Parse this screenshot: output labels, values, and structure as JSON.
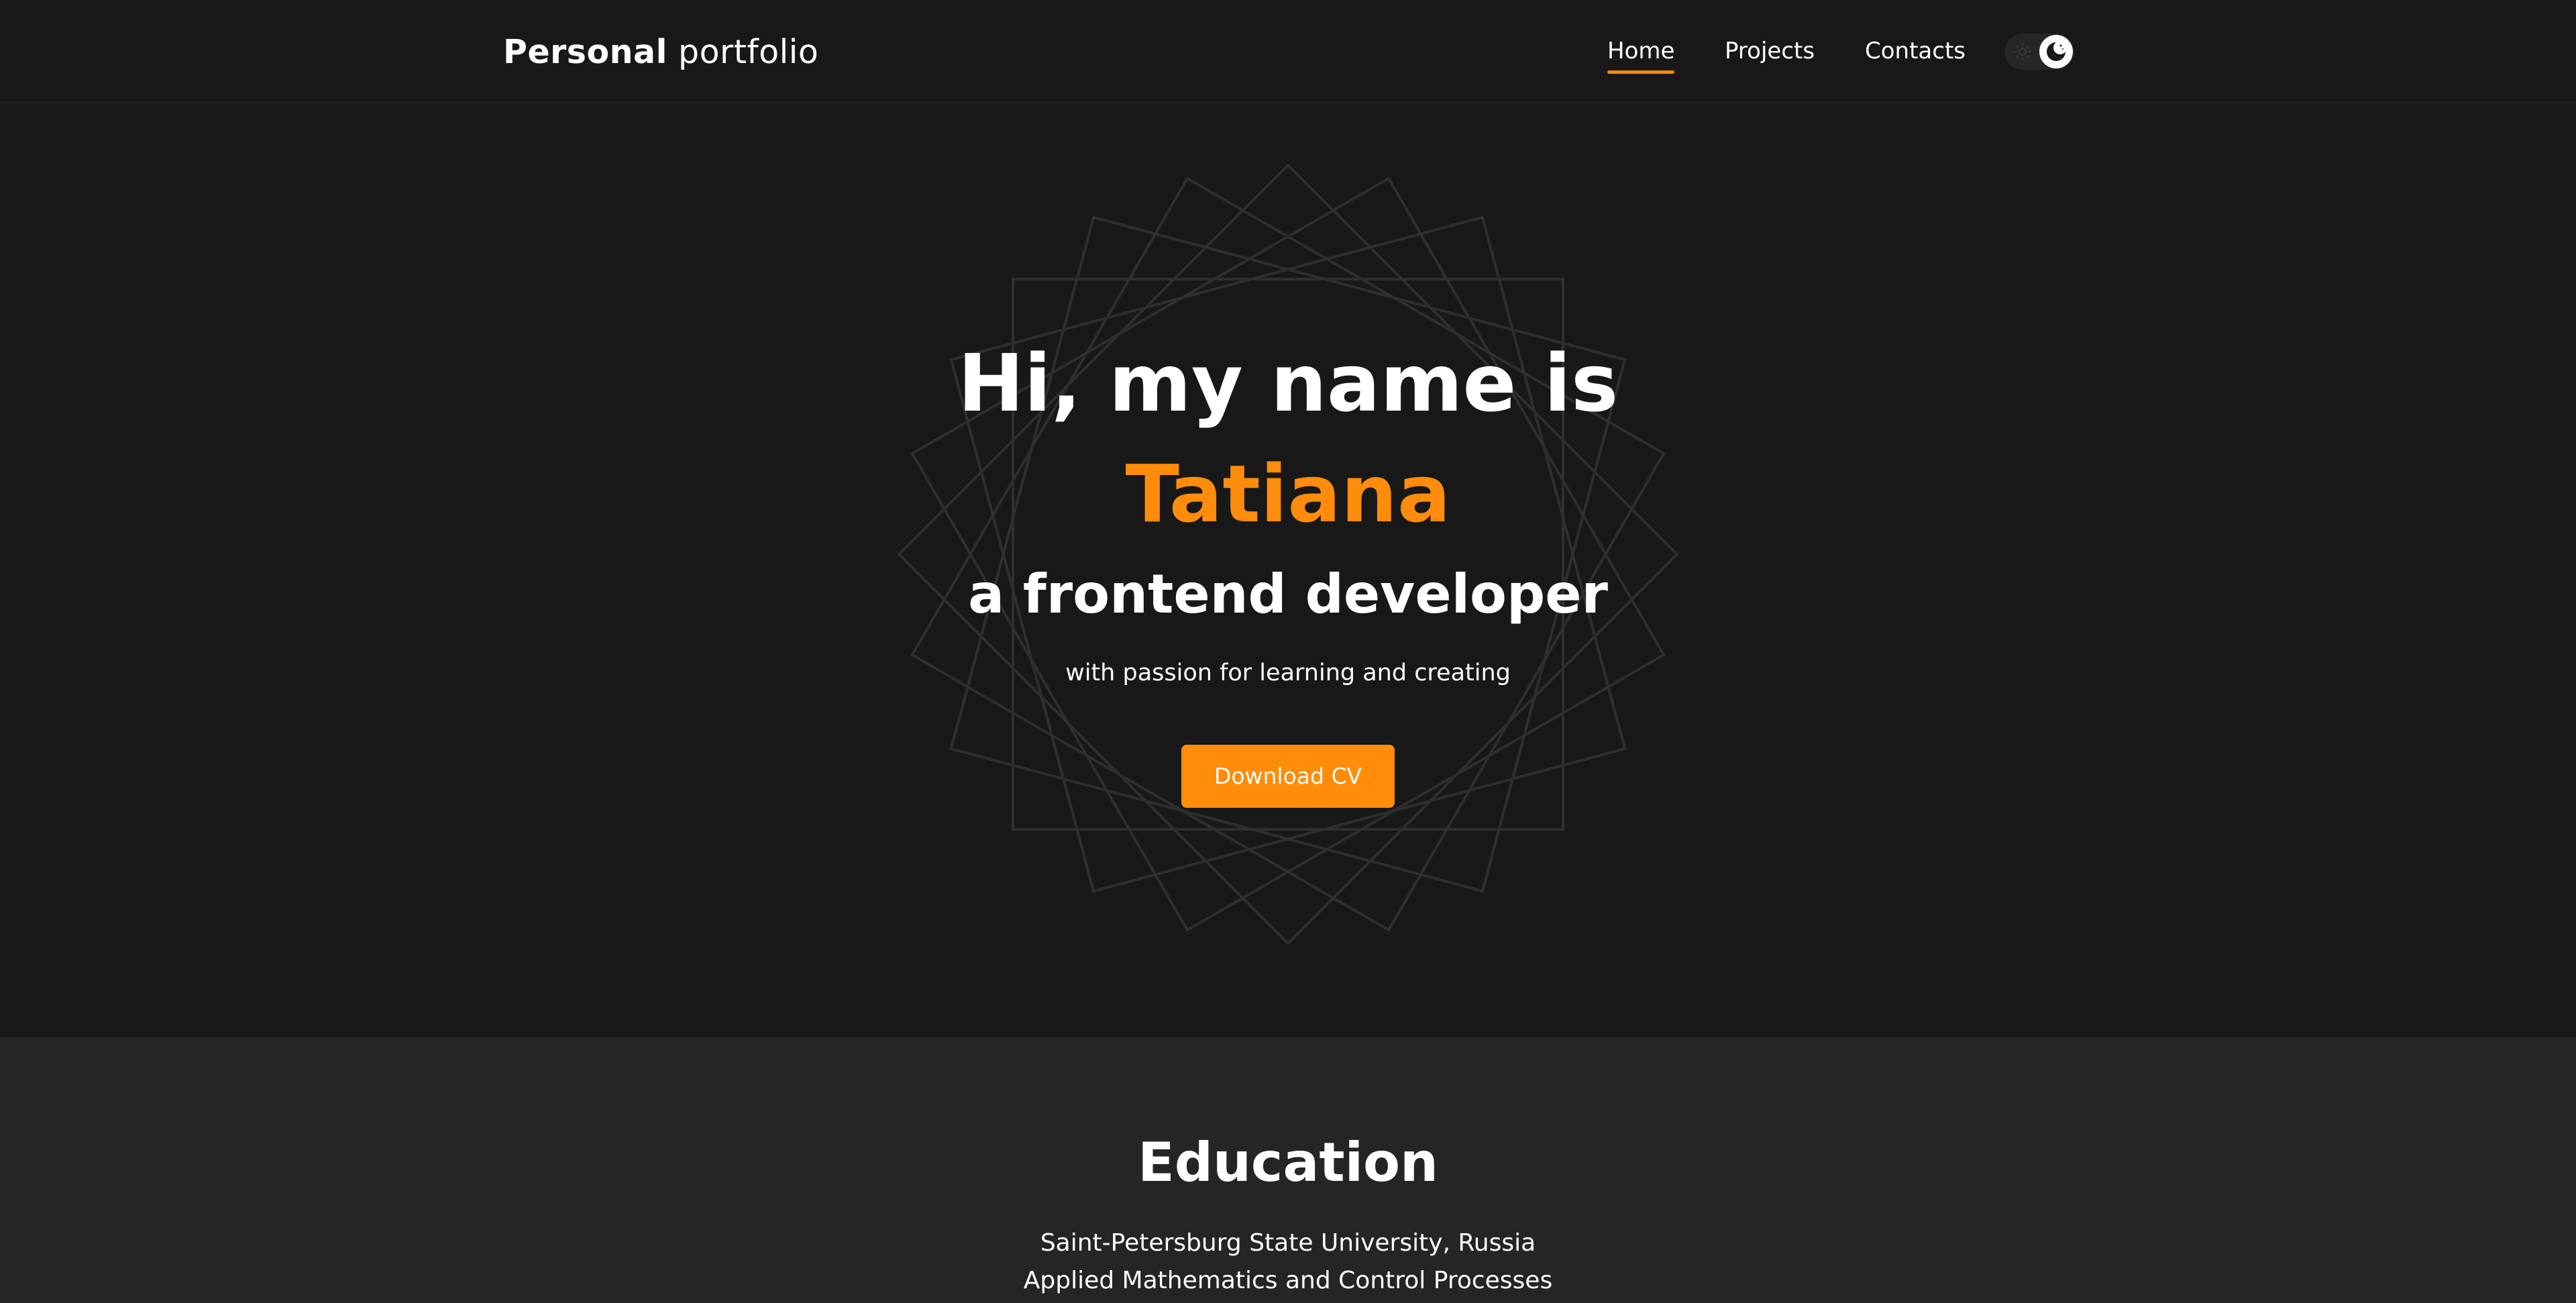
{
  "brand": {
    "bold": "Personal",
    "light": "portfolio"
  },
  "nav": {
    "items": [
      {
        "label": "Home",
        "active": true
      },
      {
        "label": "Projects",
        "active": false
      },
      {
        "label": "Contacts",
        "active": false
      }
    ],
    "theme_toggle": {
      "state": "dark",
      "icons": [
        "sun-icon",
        "moon-icon"
      ]
    }
  },
  "hero": {
    "title": "Hi, my name is",
    "name": "Tatiana",
    "role": "a frontend developer",
    "tagline": "with passion for learning and creating",
    "cta_label": "Download CV"
  },
  "education": {
    "title": "Education",
    "lines": [
      "Saint-Petersburg State University, Russia",
      "Applied Mathematics and Control Processes"
    ]
  },
  "colors": {
    "accent": "#ff8c0a",
    "background": "#181818",
    "section_alt": "#252525",
    "text": "#ffffff"
  }
}
